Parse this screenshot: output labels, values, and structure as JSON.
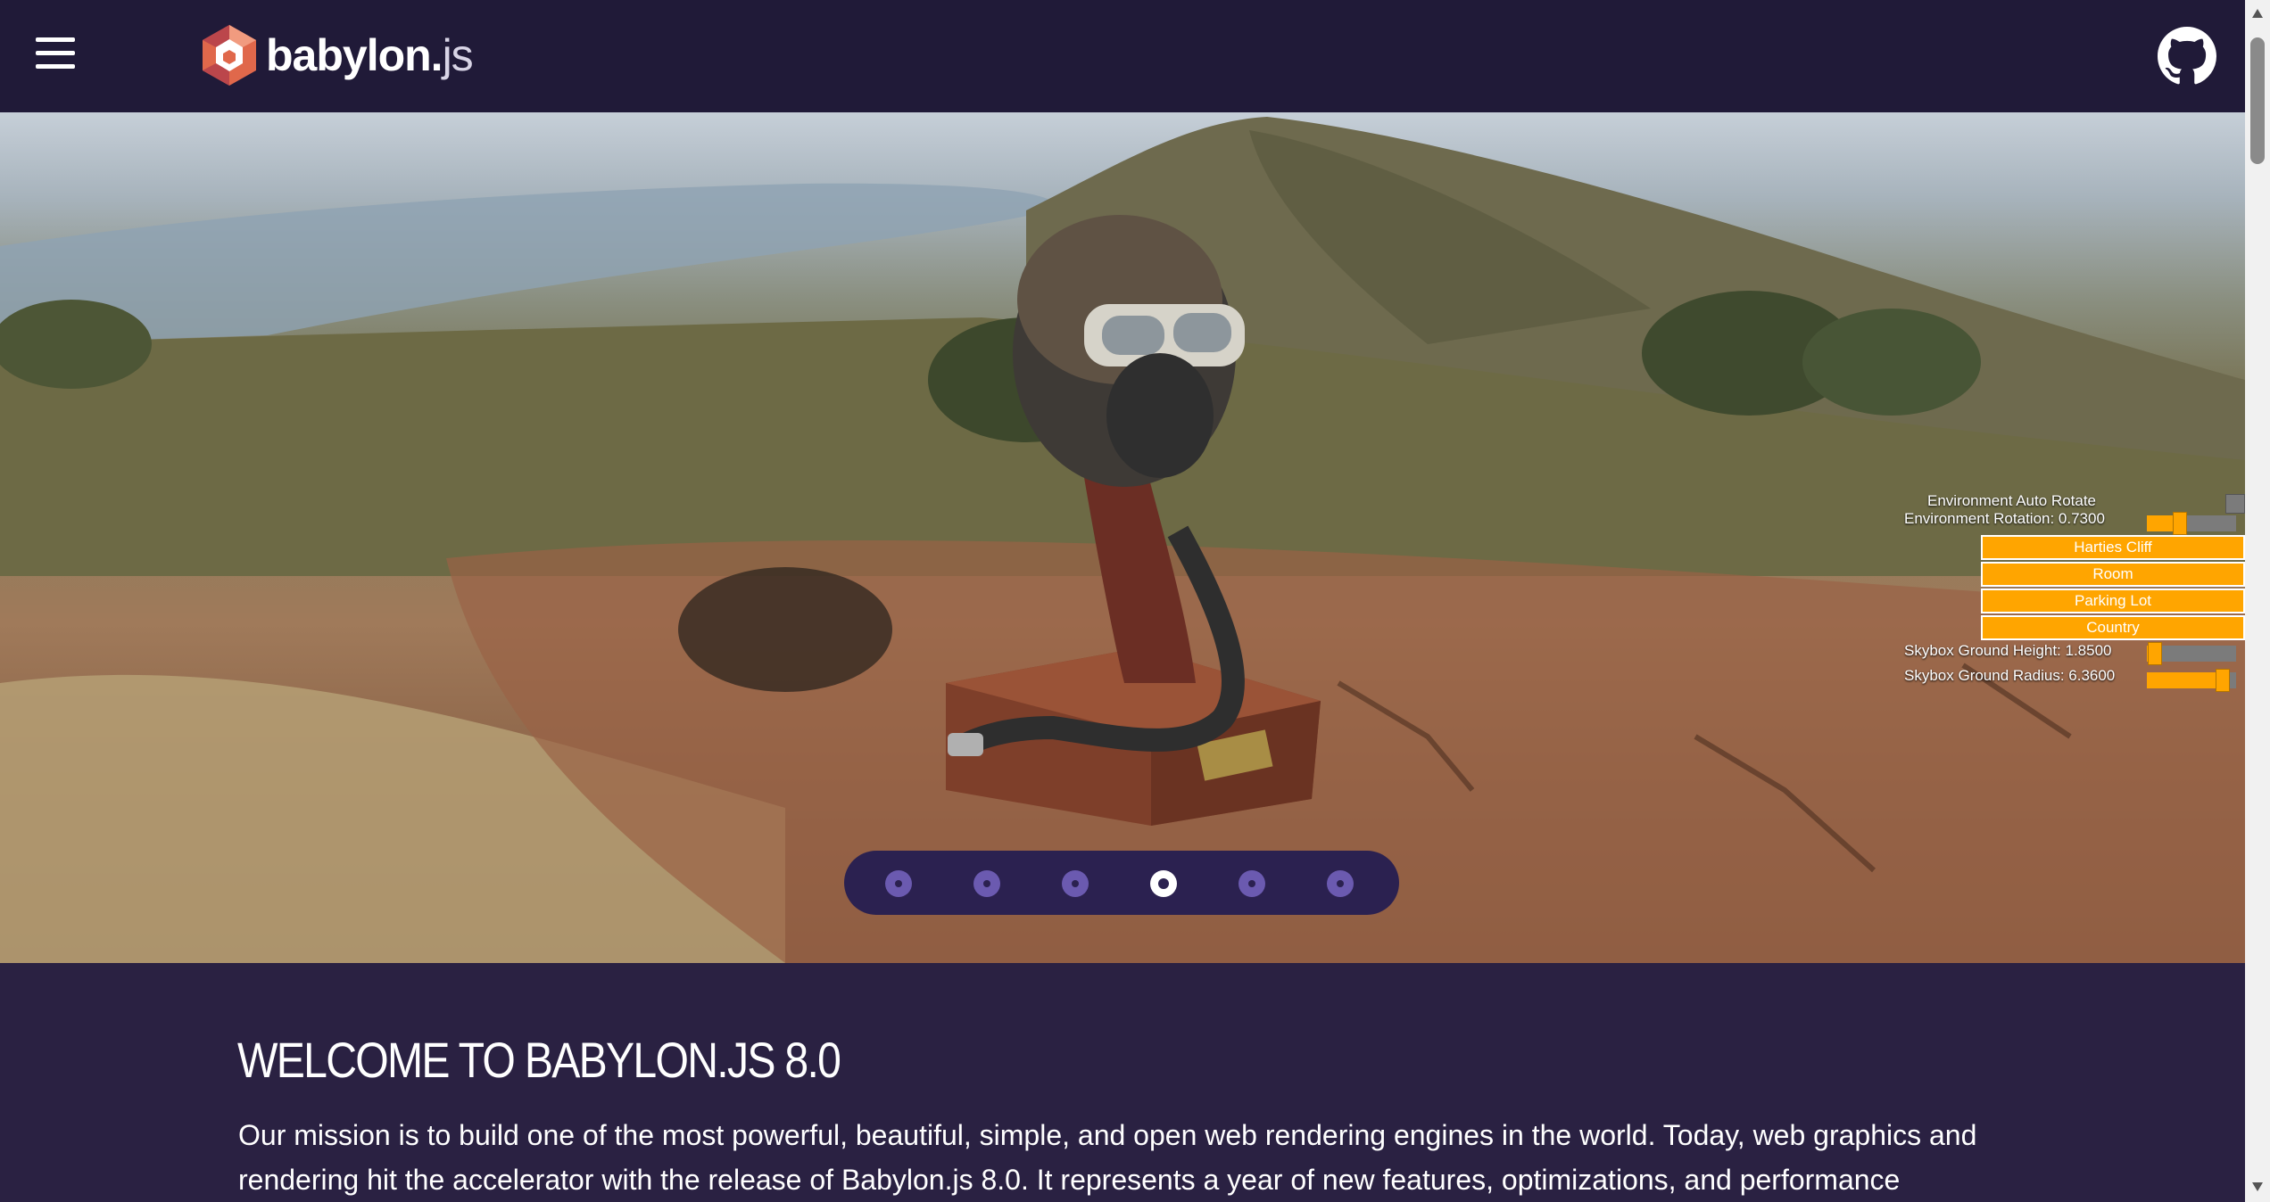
{
  "header": {
    "brand_name": "babylon.",
    "brand_suffix": "js",
    "logo_icon": "babylon-hex-logo-icon",
    "menu_icon": "hamburger-menu-icon",
    "github_icon": "github-icon"
  },
  "environment_panel": {
    "auto_rotate_label": "Environment Auto Rotate",
    "rotation_label": "Environment Rotation: 0.7300",
    "rotation_value": 0.73,
    "buttons": [
      "Harties Cliff",
      "Room",
      "Parking Lot",
      "Country"
    ],
    "ground_height_label": "Skybox Ground Height: 1.8500",
    "ground_height_value": 1.85,
    "ground_radius_label": "Skybox Ground Radius: 6.3600",
    "ground_radius_value": 6.36
  },
  "carousel": {
    "count": 6,
    "active_index": 3
  },
  "main": {
    "title": "WELCOME TO BABYLON.JS 8.0",
    "paragraph": "Our mission is to build one of the most powerful, beautiful, simple, and open web rendering engines in the world. Today, web graphics and rendering hit the accelerator with the release of Babylon.js 8.0. It represents a year of new features, optimizations, and performance"
  },
  "colors": {
    "header_bg": "#201a38",
    "page_bg": "#2a2142",
    "accent_orange": "#ffa500",
    "dot_purple": "#6b5ab0"
  }
}
